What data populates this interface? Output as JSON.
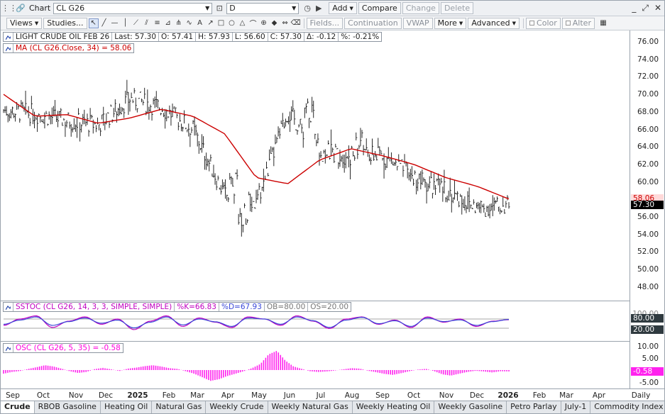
{
  "titlebar": {
    "window_title": "Chart",
    "symbol": "CL G26",
    "interval": "D",
    "add_label": "Add",
    "compare_label": "Compare",
    "change_label": "Change",
    "delete_label": "Delete"
  },
  "toolbar": {
    "views_label": "Views",
    "studies_label": "Studies...",
    "fields_label": "Fields...",
    "continuation_label": "Continuation",
    "vwap_label": "VWAP",
    "more_label": "More",
    "advanced_label": "Advanced",
    "color_label": "Color",
    "alter_label": "Alter"
  },
  "price_legend": {
    "name": "LIGHT CRUDE OIL FEB 26",
    "last": "Last: 57.30",
    "open": "O: 57.41",
    "high": "H: 57.93",
    "low": "L: 56.60",
    "close": "C: 57.30",
    "delta": "Δ: -0.12",
    "pct": "%: -0.21%"
  },
  "ma_legend": {
    "text": "MA (CL G26.Close, 34) = 58.06",
    "color": "#cc0000"
  },
  "stoch_legend": {
    "name": "SSTOC (CL G26, 14, 3, 3, SIMPLE, SIMPLE)",
    "k": "%K=66.83",
    "d": "%D=67.93",
    "ob": "OB=80.00",
    "os": "OS=20.00"
  },
  "osc_legend": {
    "text": "OSC (CL G26, 5, 35) = -0.58"
  },
  "price_axis": {
    "ticks": [
      "76.00",
      "74.00",
      "72.00",
      "70.00",
      "68.00",
      "66.00",
      "64.00",
      "62.00",
      "60.00",
      "58.00",
      "56.00",
      "54.00",
      "52.00",
      "50.00",
      "48.00"
    ],
    "ma_tag": "58.06",
    "last_tag": "57.30"
  },
  "stoch_axis": {
    "top_tick": "100.00",
    "ob_tag": "80.00",
    "os_tag": "20.00"
  },
  "osc_axis": {
    "ticks": [
      "10.00",
      "5.00",
      "0.00",
      "-5.00"
    ],
    "value_tag": "-0.58"
  },
  "date_axis": {
    "labels": [
      "Sep",
      "Oct",
      "Nov",
      "Dec",
      "2025",
      "Feb",
      "Mar",
      "Apr",
      "May",
      "Jun",
      "Jul",
      "Aug",
      "Sep",
      "Oct",
      "Nov",
      "Dec",
      "2026",
      "Feb",
      "Mar",
      "Apr",
      "May"
    ],
    "interval_label": "Daily"
  },
  "tabs": [
    "Crude",
    "RBOB Gasoline",
    "Heating Oil",
    "Natural Gas",
    "Weekly Crude",
    "Weekly Natural Gas",
    "Weekly Heating Oil",
    "Weekly Gasoline",
    "Petro Parlay",
    "July-1",
    "Commodity Index",
    "July",
    "July-2"
  ],
  "colors": {
    "ma": "#cc0000",
    "stoch_k": "#c000c0",
    "stoch_d": "#3a48d8",
    "osc": "#ff22ee",
    "last_tag_bg": "#000000",
    "ma_tag_bg": "#ffd9d9",
    "stoch_tag_bg": "#2f3a3f",
    "osc_tag_bg": "#ff22ee"
  },
  "chart_data": [
    {
      "type": "ohlc",
      "title": "LIGHT CRUDE OIL FEB 26",
      "ylim": [
        48,
        76
      ],
      "x": [
        "2024-09",
        "2024-10",
        "2024-11",
        "2024-12",
        "2025-01",
        "2025-02",
        "2025-03",
        "2025-04",
        "2025-05",
        "2025-06",
        "2025-07",
        "2025-08",
        "2025-09",
        "2025-10",
        "2025-11",
        "2025-12",
        "2026-01"
      ],
      "approx_close": [
        68.2,
        67.8,
        67.0,
        66.5,
        69.5,
        68.5,
        66.0,
        58.5,
        57.5,
        68.0,
        63.5,
        63.0,
        63.0,
        60.5,
        59.0,
        57.0,
        57.3
      ],
      "series": [
        {
          "name": "MA (CL G26.Close, 34)",
          "x": [
            "2024-09",
            "2024-10",
            "2024-11",
            "2024-12",
            "2025-01",
            "2025-02",
            "2025-03",
            "2025-04",
            "2025-05",
            "2025-06",
            "2025-07",
            "2025-08",
            "2025-09",
            "2025-10",
            "2025-11",
            "2025-12",
            "2026-01"
          ],
          "values": [
            70.0,
            67.5,
            67.7,
            66.7,
            67.3,
            68.3,
            67.5,
            65.5,
            60.5,
            59.8,
            62.5,
            63.8,
            63.0,
            62.0,
            60.5,
            59.5,
            58.06
          ]
        }
      ]
    },
    {
      "type": "line",
      "title": "SSTOC (CL G26, 14, 3, 3, SIMPLE, SIMPLE)",
      "ylim": [
        0,
        100
      ],
      "series": [
        {
          "name": "%K",
          "values": [
            40,
            70,
            85,
            30,
            60,
            80,
            45,
            70,
            20,
            60,
            85,
            35,
            75,
            55,
            30,
            80,
            70,
            40,
            85,
            60,
            25,
            70,
            80,
            45,
            65,
            30,
            80,
            55,
            70,
            35,
            60,
            66.83
          ]
        },
        {
          "name": "%D",
          "values": [
            45,
            65,
            80,
            40,
            58,
            75,
            50,
            65,
            28,
            55,
            80,
            42,
            70,
            57,
            35,
            75,
            70,
            45,
            80,
            62,
            30,
            65,
            78,
            48,
            62,
            35,
            75,
            58,
            66,
            40,
            58,
            67.93
          ]
        }
      ]
    },
    {
      "type": "bar",
      "title": "OSC (CL G26, 5, 35)",
      "ylim": [
        -6,
        11
      ],
      "values": [
        -1.5,
        -0.8,
        -0.4,
        0.5,
        1.2,
        2.0,
        1.5,
        0.6,
        -0.5,
        -1.2,
        -0.8,
        0.4,
        0.9,
        0.3,
        -0.4,
        0.6,
        1.0,
        1.6,
        2.0,
        1.5,
        0.8,
        0.5,
        -0.5,
        -1.5,
        -3.0,
        -4.5,
        -3.8,
        -2.5,
        -1.5,
        -0.5,
        0.8,
        2.5,
        6.5,
        8.0,
        4.0,
        1.5,
        0.5,
        -0.5,
        -0.8,
        -0.6,
        -0.2,
        0.3,
        0.8,
        0.6,
        -0.3,
        -0.9,
        -1.6,
        -2.0,
        -1.3,
        -0.5,
        0.2,
        0.5,
        -0.5,
        -1.8,
        -2.3,
        -1.5,
        -0.8,
        -0.3,
        -0.6,
        -1.0,
        -0.5,
        -0.58
      ]
    }
  ]
}
